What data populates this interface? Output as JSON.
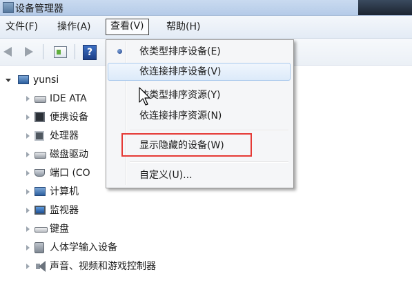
{
  "window": {
    "title": "设备管理器"
  },
  "menubar": {
    "items": [
      {
        "label": "文件(F)"
      },
      {
        "label": "操作(A)"
      },
      {
        "label": "查看(V)"
      },
      {
        "label": "帮助(H)"
      }
    ]
  },
  "toolbar": {
    "icons": [
      "back-arrow-icon",
      "forward-arrow-icon",
      "properties-icon",
      "help-icon"
    ],
    "help_glyph": "?"
  },
  "tree": {
    "root": "yunsi",
    "nodes": [
      {
        "label": "IDE ATA",
        "icon": "ide-controller-icon"
      },
      {
        "label": "便携设备",
        "icon": "portable-device-icon"
      },
      {
        "label": "处理器",
        "icon": "processor-icon"
      },
      {
        "label": "磁盘驱动",
        "icon": "disk-drive-icon"
      },
      {
        "label": "端口 (CO",
        "icon": "port-icon"
      },
      {
        "label": "计算机",
        "icon": "computer-icon"
      },
      {
        "label": "监视器",
        "icon": "monitor-icon"
      },
      {
        "label": "键盘",
        "icon": "keyboard-icon"
      },
      {
        "label": "人体学输入设备",
        "icon": "hid-icon"
      },
      {
        "label": "声音、视频和游戏控制器",
        "icon": "sound-icon"
      }
    ]
  },
  "view_menu": {
    "items": [
      {
        "label": "依类型排序设备(E)",
        "selected": true
      },
      {
        "label": "依连接排序设备(V)",
        "hover": true
      },
      {
        "label": "依类型排序资源(Y)"
      },
      {
        "label": "依连接排序资源(N)"
      },
      {
        "label": "显示隐藏的设备(W)",
        "highlighted": true
      },
      {
        "label": "自定义(U)..."
      }
    ]
  },
  "colors": {
    "highlight_box": "#e53935",
    "menu_hover": "#dceaf9",
    "title_bar": "#c9daf0"
  }
}
